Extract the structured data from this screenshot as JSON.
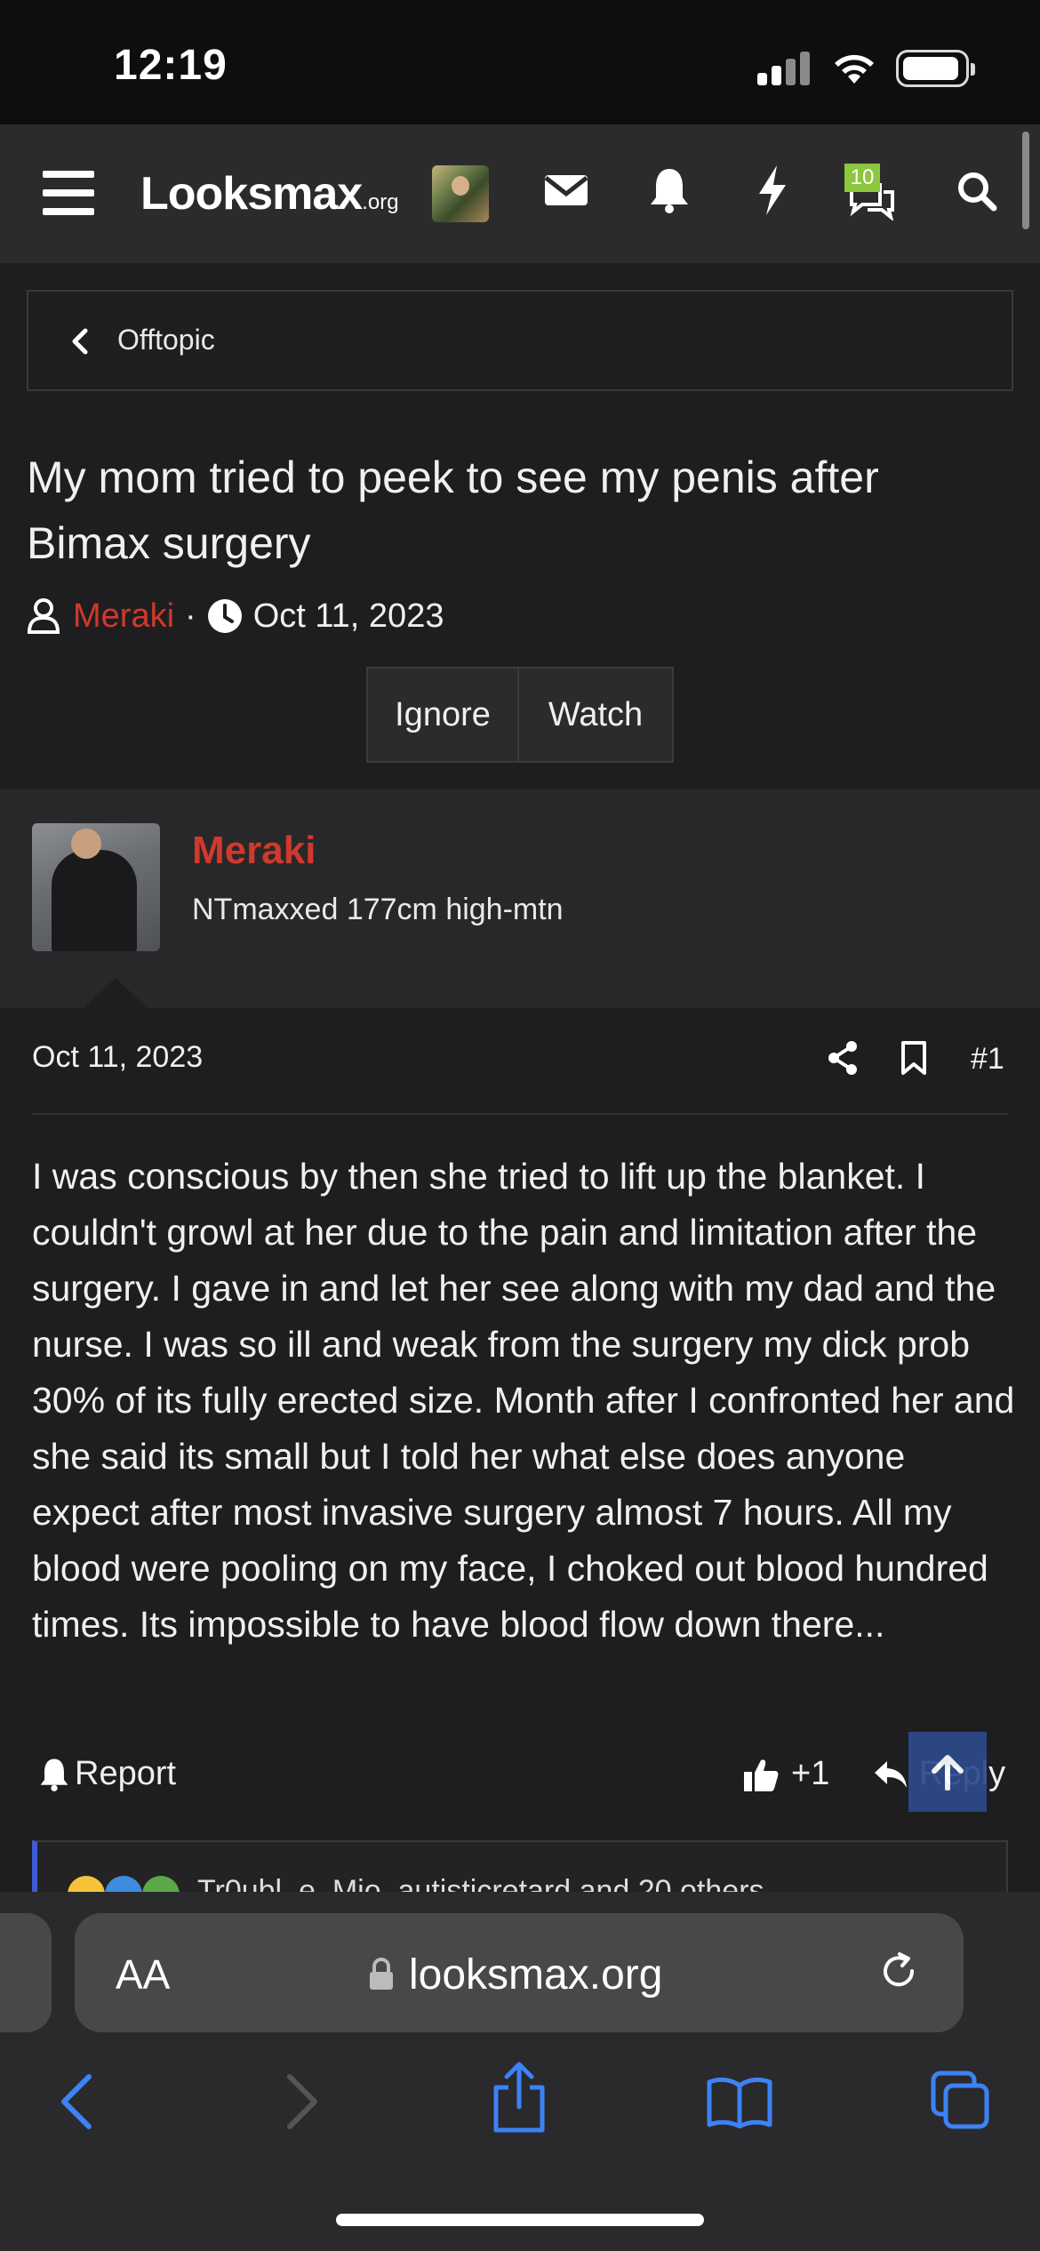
{
  "status_bar": {
    "time": "12:19"
  },
  "header": {
    "logo_main": "Looksmax",
    "logo_suffix": ".org",
    "conversations_badge": "10"
  },
  "breadcrumb": {
    "label": "Offtopic"
  },
  "thread": {
    "title": "My mom tried to peek to see my penis after Bimax surgery",
    "author": "Meraki",
    "separator": "·",
    "date": "Oct 11, 2023",
    "ignore_label": "Ignore",
    "watch_label": "Watch"
  },
  "post": {
    "username": "Meraki",
    "user_title": "NTmaxxed 177cm high-mtn",
    "date": "Oct 11, 2023",
    "number": "#1",
    "body": "I was conscious by then she tried to lift up the blanket. I couldn't growl at her due to the pain and limitation after the surgery. I gave in and let her see along with my dad and the nurse. I was so ill and weak from the surgery my dick prob 30% of its fully erected size. Month after I confronted her and she said its small but I told her what else does anyone expect after most invasive surgery almost 7 hours. All my blood were pooling on my face, I choked out blood hundred times. Its impossible to have blood flow down there...",
    "report_label": "Report",
    "like_label": "+1",
    "reply_label": "Reply",
    "reactions_text": "Tr0ubl_e, Mio, autisticretard and 20 others"
  },
  "safari": {
    "aa_label": "AA",
    "url": "looksmax.org"
  },
  "colors": {
    "author_red": "#d0392b",
    "badge_green": "#8dc63f",
    "safari_blue": "#3d82f6",
    "reaction_bar": "#3e5ad6"
  }
}
